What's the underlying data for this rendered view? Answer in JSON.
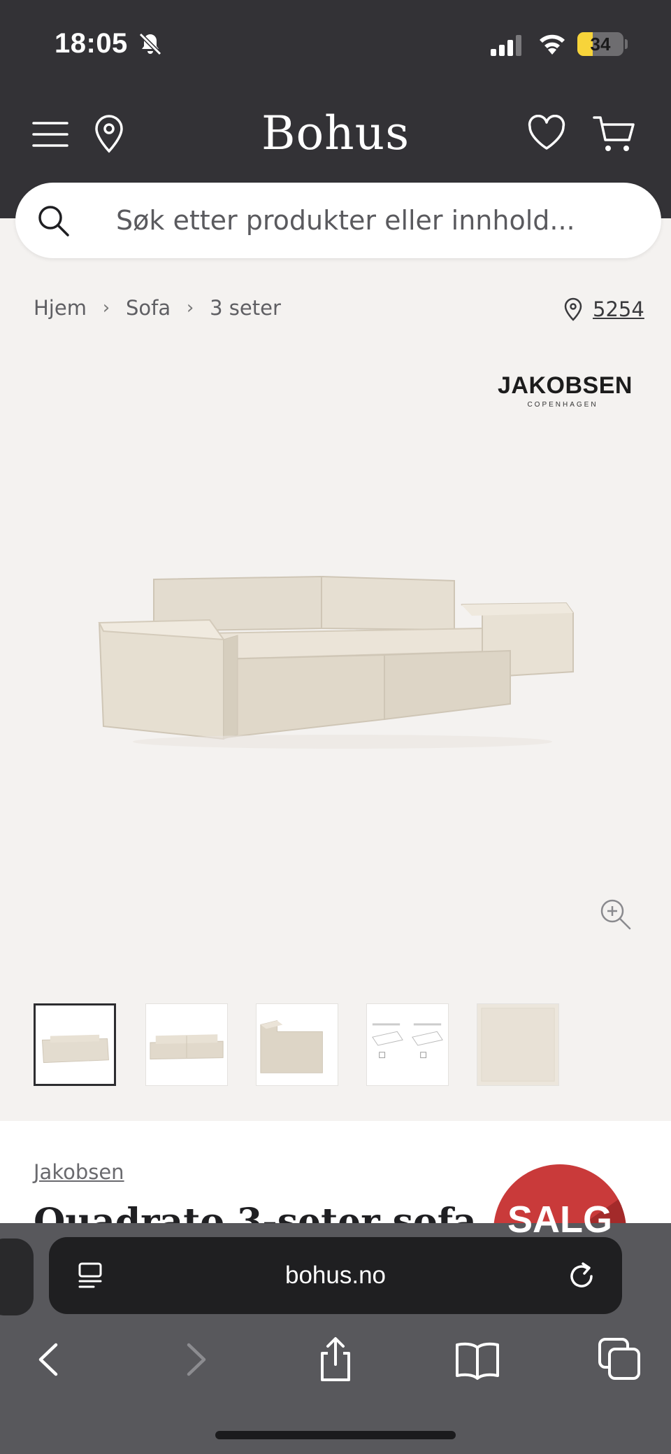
{
  "status_bar": {
    "time": "18:05",
    "battery_level": "34",
    "battery_fraction": 0.34,
    "icons": [
      "bell-slash-icon",
      "cellular-signal-icon",
      "wifi-icon",
      "battery-icon"
    ]
  },
  "header": {
    "logo": "Bohus",
    "icons": [
      "hamburger-menu-icon",
      "location-pin-icon",
      "heart-icon",
      "shopping-cart-icon"
    ],
    "background_color": "#333236"
  },
  "search": {
    "placeholder": "Søk etter produkter eller innhold..."
  },
  "breadcrumb": {
    "items": [
      {
        "label": "Hjem"
      },
      {
        "label": "Sofa"
      },
      {
        "label": "3 seter"
      }
    ],
    "store_number": "5254"
  },
  "product": {
    "brand_logo_name": "JAKOBSEN",
    "brand_logo_sub": "COPENHAGEN",
    "brand_link": "Jakobsen",
    "title": "Quadrato 3-seter sofa",
    "sale_badge": "SALG",
    "thumbnail_count": 5,
    "sale_color": "#c93a3a"
  },
  "browser": {
    "url": "bohus.no",
    "toolbar_icons": [
      "back-icon",
      "forward-icon",
      "share-icon",
      "bookmarks-icon",
      "tabs-icon"
    ]
  }
}
